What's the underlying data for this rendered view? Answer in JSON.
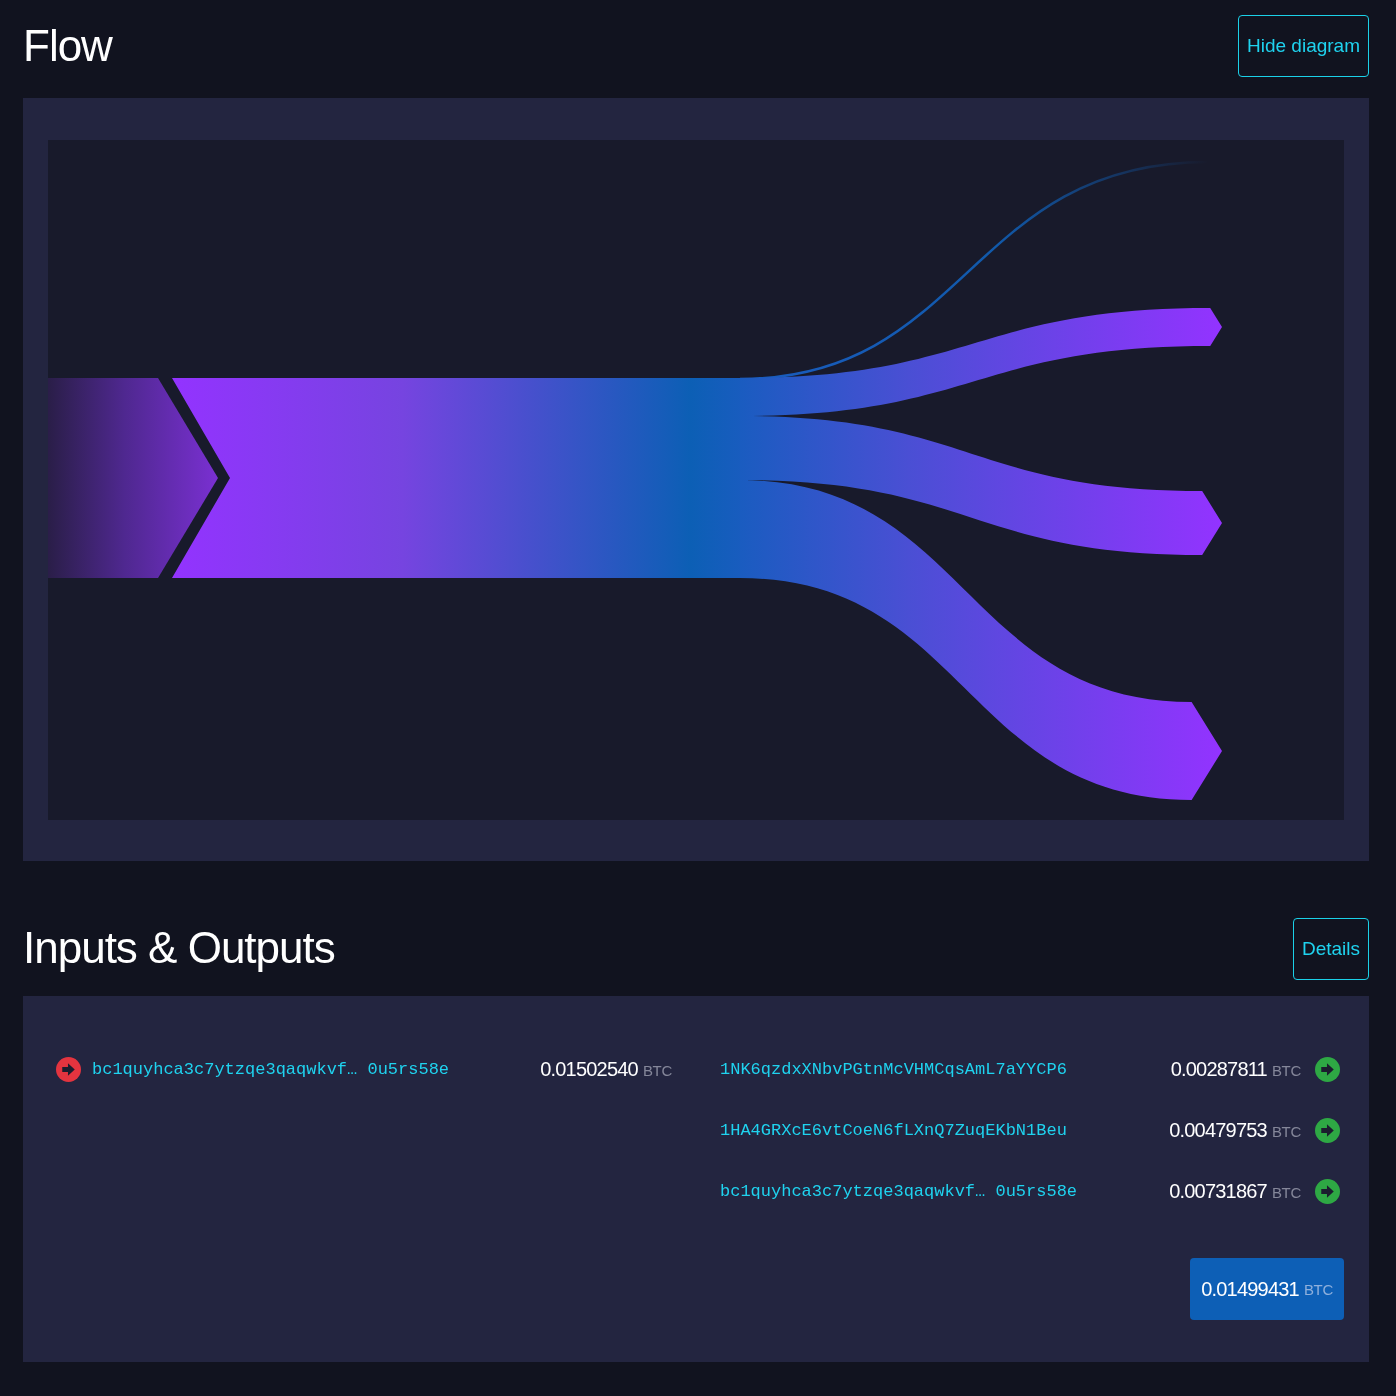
{
  "flow": {
    "title": "Flow",
    "toggle_button": "Hide diagram"
  },
  "inputs_outputs": {
    "title": "Inputs & Outputs",
    "details_button": "Details",
    "inputs": [
      {
        "address": "bc1quyhca3c7ytzqe3qaqwkvf… 0u5rs58e",
        "amount": "0.01502540",
        "unit": "BTC"
      }
    ],
    "outputs": [
      {
        "address": "1NK6qzdxXNbvPGtnMcVHMCqsAmL7aYYCP6",
        "amount": "0.00287811",
        "unit": "BTC"
      },
      {
        "address": "1HA4GRXcE6vtCoeN6fLXnQ7ZuqEKbN1Beu",
        "amount": "0.00479753",
        "unit": "BTC"
      },
      {
        "address": "bc1quyhca3c7ytzqe3qaqwkvf… 0u5rs58e",
        "amount": "0.00731867",
        "unit": "BTC"
      }
    ],
    "total": {
      "amount": "0.01499431",
      "unit": "BTC"
    }
  }
}
